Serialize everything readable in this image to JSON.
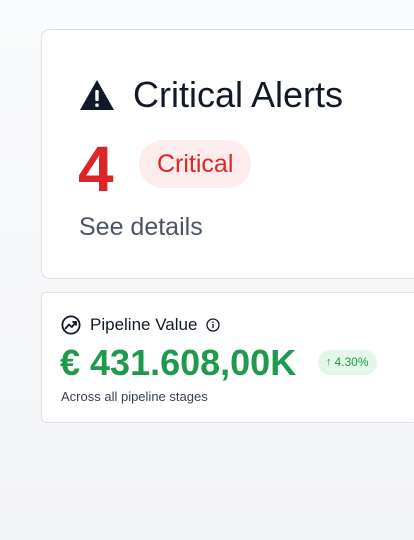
{
  "alerts_card": {
    "title": "Critical Alerts",
    "icon": "warning-triangle-icon",
    "count": "4",
    "badge": "Critical",
    "link": "See details"
  },
  "pipeline_card": {
    "title": "Pipeline Value",
    "icon": "trending-up-icon",
    "info_icon": "info-icon",
    "value": "€ 431.608,00K",
    "change": "4.30%",
    "change_icon": "arrow-up-icon",
    "subtitle": "Across all pipeline stages"
  },
  "colors": {
    "critical": "#dc2626",
    "critical_bg": "#fdecec",
    "positive": "#1e9a4c",
    "positive_bg": "#e4f6ea"
  }
}
